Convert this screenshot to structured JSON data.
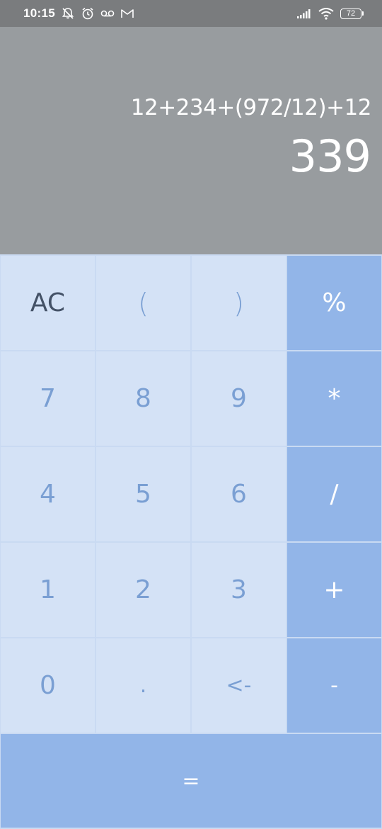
{
  "status_bar": {
    "time": "10:15",
    "battery_level": "72",
    "left_icons": [
      "notifications-off-icon",
      "alarm-icon",
      "voicemail-icon",
      "gmail-icon"
    ],
    "right_icons": [
      "signal-icon",
      "wifi-icon",
      "battery-icon"
    ]
  },
  "display": {
    "expression": "12+234+(972/12)+12",
    "result": "339"
  },
  "keypad": {
    "rows": [
      [
        "AC",
        "(",
        ")",
        "%"
      ],
      [
        "7",
        "8",
        "9",
        "*"
      ],
      [
        "4",
        "5",
        "6",
        "/"
      ],
      [
        "1",
        "2",
        "3",
        "+"
      ],
      [
        "0",
        ".",
        "<-",
        "-"
      ]
    ],
    "equals": "="
  },
  "colors": {
    "status_bar_bg": "#7a7c7e",
    "display_bg": "#989c9f",
    "key_light_bg": "#d4e2f6",
    "key_light_text": "#7a9fd3",
    "key_dark_bg": "#92b5e8",
    "key_dark_text": "#ffffff",
    "ac_text": "#445267",
    "grid_line": "#c9daf2"
  }
}
